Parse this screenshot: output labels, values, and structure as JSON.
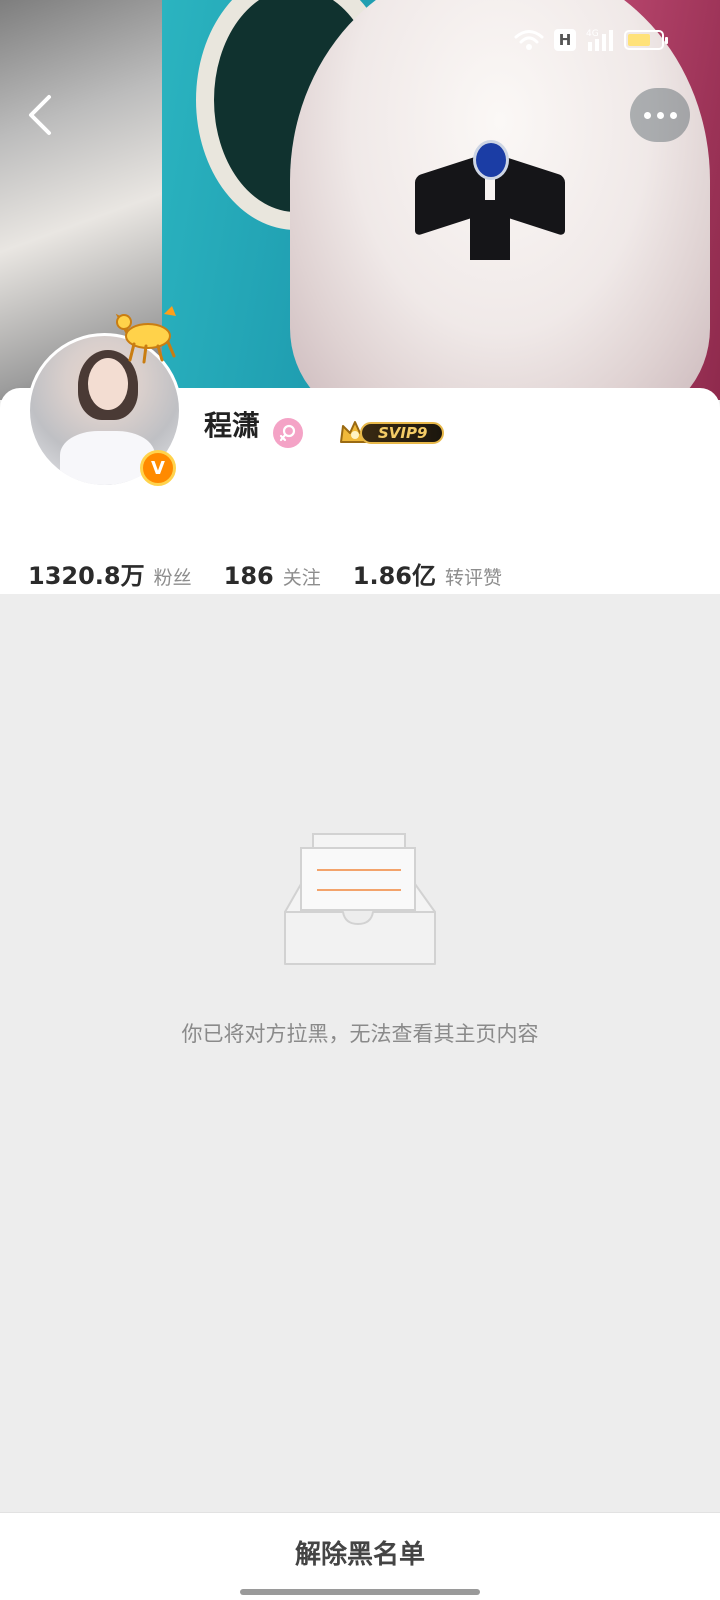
{
  "status_bar": {
    "network_badge": "H",
    "network_type": "4G",
    "battery_color": "#ffe27a"
  },
  "profile": {
    "name": "程潇",
    "vip_label": "SVIP9",
    "verified_label": "V",
    "stats": [
      {
        "value": "1320.8万",
        "label": "粉丝"
      },
      {
        "value": "186",
        "label": "关注"
      },
      {
        "value": "1.86亿",
        "label": "转评赞"
      }
    ]
  },
  "empty_state": {
    "message": "你已将对方拉黑，无法查看其主页内容"
  },
  "bottom": {
    "unblock_label": "解除黑名单"
  },
  "icons": [
    "back-icon",
    "more-icon",
    "wifi-icon",
    "signal-icon",
    "battery-icon",
    "female-icon",
    "crown-icon",
    "verified-icon",
    "empty-inbox-icon"
  ],
  "colors": {
    "accent_orange": "#ff8a00",
    "vip_gold": "#e7b84a",
    "female_pink": "#f4a3c6",
    "page_bg": "#ededed"
  }
}
